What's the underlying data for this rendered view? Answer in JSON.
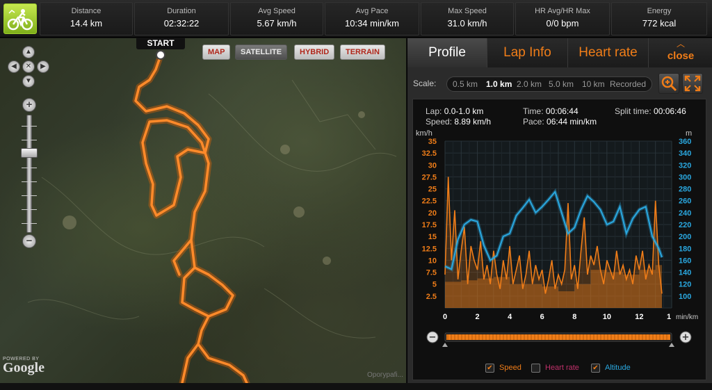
{
  "header": {
    "logo_icon": "cyclist-icon",
    "stats": [
      {
        "label": "Distance",
        "value": "14.4 km"
      },
      {
        "label": "Duration",
        "value": "02:32:22"
      },
      {
        "label": "Avg Speed",
        "value": "5.67 km/h"
      },
      {
        "label": "Avg Pace",
        "value": "10:34 min/km"
      },
      {
        "label": "Max Speed",
        "value": "31.0 km/h"
      },
      {
        "label": "HR Avg/HR Max",
        "value": "0/0 bpm"
      },
      {
        "label": "Energy",
        "value": "772 kcal"
      }
    ]
  },
  "map": {
    "start_label": "START",
    "types": [
      {
        "label": "MAP",
        "active": false
      },
      {
        "label": "SATELLITE",
        "active": true
      },
      {
        "label": "HYBRID",
        "active": false
      },
      {
        "label": "TERRAIN",
        "active": false
      }
    ],
    "powered_by": "POWERED BY",
    "google": "Google",
    "copyright": "Opoгуpafi...",
    "route_color": "#ff7a1a"
  },
  "panel": {
    "tabs": [
      {
        "label": "Profile",
        "active": true
      },
      {
        "label": "Lap Info",
        "active": false
      },
      {
        "label": "Heart rate",
        "active": false
      }
    ],
    "close_label": "close",
    "scale": {
      "label": "Scale:",
      "options": [
        "0.5 km",
        "1.0 km",
        "2.0 km",
        "5.0 km",
        "10 km",
        "Recorded"
      ],
      "selected": "1.0 km"
    },
    "info": {
      "lap_label": "Lap:",
      "lap_value": "0.0-1.0 km",
      "speed_label": "Speed:",
      "speed_value": "8.89 km/h",
      "time_label": "Time:",
      "time_value": "00:06:44",
      "pace_label": "Pace:",
      "pace_value": "06:44 min/km",
      "split_label": "Split time:",
      "split_value": "00:06:46"
    },
    "legend": {
      "speed": {
        "label": "Speed",
        "checked": true
      },
      "heart_rate": {
        "label": "Heart rate",
        "checked": false
      },
      "altitude": {
        "label": "Altitude",
        "checked": true
      }
    }
  },
  "chart_data": {
    "type": "line",
    "left_unit": "km/h",
    "right_unit": "m",
    "x_unit": "min/km",
    "left_ticks": [
      "35",
      "32.5",
      "30",
      "27.5",
      "25",
      "22.5",
      "20",
      "17.5",
      "15",
      "12.5",
      "10",
      "7.5",
      "5",
      "2.5"
    ],
    "right_ticks": [
      "360",
      "340",
      "320",
      "300",
      "280",
      "260",
      "240",
      "220",
      "200",
      "180",
      "160",
      "140",
      "120",
      "100"
    ],
    "x_ticks": [
      "0",
      "2",
      "4",
      "6",
      "8",
      "10",
      "12",
      "1"
    ],
    "ylim_left": [
      0,
      35
    ],
    "ylim_right": [
      80,
      360
    ],
    "xlim": [
      0,
      14
    ],
    "colors": {
      "speed": "#f07d18",
      "altitude": "#2aa8e0",
      "heart_rate": "#c0306a"
    },
    "series": [
      {
        "name": "Speed",
        "x": [
          0,
          0.2,
          0.4,
          0.6,
          0.8,
          1.0,
          1.2,
          1.4,
          1.6,
          1.8,
          2.0,
          2.2,
          2.4,
          2.6,
          2.8,
          3.0,
          3.2,
          3.4,
          3.6,
          3.8,
          4.0,
          4.2,
          4.4,
          4.6,
          4.8,
          5.0,
          5.2,
          5.4,
          5.6,
          5.8,
          6.0,
          6.2,
          6.4,
          6.6,
          6.8,
          7.0,
          7.2,
          7.4,
          7.6,
          7.8,
          8.0,
          8.2,
          8.4,
          8.6,
          8.8,
          9.0,
          9.2,
          9.4,
          9.6,
          9.8,
          10.0,
          10.2,
          10.4,
          10.6,
          10.8,
          11.0,
          11.2,
          11.4,
          11.6,
          11.8,
          12.0,
          12.2,
          12.4,
          12.6,
          12.8,
          13.0,
          13.2,
          13.4
        ],
        "values": [
          7,
          27.5,
          10,
          20.5,
          6,
          12,
          17,
          5,
          13,
          10,
          8,
          14,
          6,
          9,
          5,
          12,
          7,
          4,
          10,
          6,
          13,
          5,
          8,
          11,
          4,
          7,
          12,
          5,
          9,
          6,
          8,
          3,
          6,
          10,
          4,
          7,
          5,
          8,
          22,
          6,
          9,
          4,
          12,
          19,
          7,
          11,
          9,
          13,
          8,
          5,
          10,
          8,
          6,
          12,
          7,
          9,
          6,
          8,
          5,
          11,
          8,
          12,
          6,
          9,
          7,
          22.5,
          9,
          3
        ]
      },
      {
        "name": "Altitude",
        "x": [
          0,
          0.4,
          0.8,
          1.2,
          1.6,
          2.0,
          2.4,
          2.8,
          3.2,
          3.6,
          4.0,
          4.4,
          4.8,
          5.2,
          5.6,
          6.0,
          6.4,
          6.8,
          7.2,
          7.6,
          8.0,
          8.4,
          8.8,
          9.2,
          9.6,
          10.0,
          10.4,
          10.8,
          11.2,
          11.6,
          12.0,
          12.4,
          12.8,
          13.2,
          13.4
        ],
        "values": [
          150,
          145,
          195,
          220,
          228,
          225,
          185,
          160,
          168,
          200,
          205,
          235,
          248,
          262,
          240,
          250,
          262,
          275,
          240,
          205,
          215,
          245,
          268,
          258,
          245,
          220,
          225,
          250,
          205,
          230,
          245,
          250,
          200,
          180,
          165
        ]
      },
      {
        "name": "Lap average",
        "x": [
          0,
          1,
          2,
          3,
          4,
          5,
          6,
          7,
          8,
          9,
          10,
          11,
          12,
          13
        ],
        "values": [
          5.5,
          5.8,
          6.2,
          6.5,
          5.0,
          5.0,
          4.5,
          3.5,
          5.0,
          8.0,
          7.5,
          7.0,
          8.0,
          9.0
        ]
      }
    ]
  }
}
